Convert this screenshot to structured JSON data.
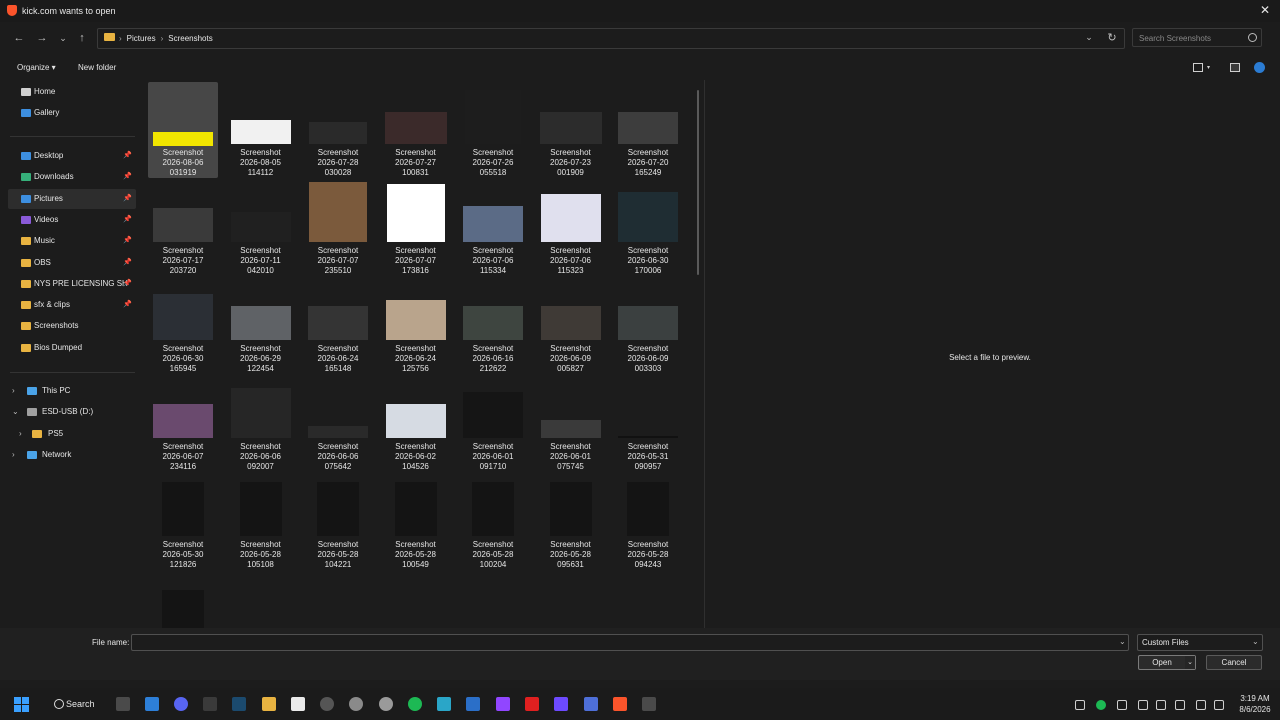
{
  "window": {
    "title": "kick.com wants to open",
    "close_glyph": "✕"
  },
  "nav": {
    "back": "←",
    "forward": "→",
    "recent": "⌄",
    "up": "↑",
    "breadcrumb": [
      "Pictures",
      "Screenshots"
    ],
    "breadcrumb_sep": "›",
    "address_dropdown": "⌄",
    "refresh": "↻",
    "search_placeholder": "Search Screenshots"
  },
  "commands": {
    "organize": "Organize ▾",
    "new_folder": "New folder"
  },
  "sidebar": {
    "quick": [
      {
        "label": "Home",
        "icon": "home-icon"
      },
      {
        "label": "Gallery",
        "icon": "gallery-icon"
      }
    ],
    "pinned": [
      {
        "label": "Desktop",
        "icon": "desktop-icon",
        "pinned": true
      },
      {
        "label": "Downloads",
        "icon": "downloads-icon",
        "pinned": true
      },
      {
        "label": "Pictures",
        "icon": "pictures-icon",
        "pinned": true,
        "selected": true
      },
      {
        "label": "Videos",
        "icon": "videos-icon",
        "pinned": true
      },
      {
        "label": "Music",
        "icon": "folder-icon",
        "pinned": true
      },
      {
        "label": "OBS",
        "icon": "folder-icon",
        "pinned": true
      },
      {
        "label": "NYS PRE LICENSING SH",
        "icon": "folder-icon",
        "pinned": true
      },
      {
        "label": "sfx & clips",
        "icon": "folder-icon",
        "pinned": true
      },
      {
        "label": "Screenshots",
        "icon": "folder-icon"
      },
      {
        "label": "Bios Dumped",
        "icon": "folder-icon"
      }
    ],
    "tree": [
      {
        "label": "This PC",
        "icon": "pc-icon",
        "chevron": "›"
      },
      {
        "label": "ESD-USB (D:)",
        "icon": "usb-drive-icon",
        "chevron": "⌄"
      },
      {
        "label": "PS5",
        "icon": "folder-icon",
        "chevron": "›"
      },
      {
        "label": "Network",
        "icon": "network-icon",
        "chevron": "›"
      }
    ],
    "pin_glyph": "📌"
  },
  "files": [
    {
      "name": "Screenshot\n2026-08-06\n031919",
      "thumb": "#5a5a5a",
      "accent": "#f2e600"
    },
    {
      "name": "Screenshot\n2026-08-05\n114112",
      "thumb": "#f1f1f1"
    },
    {
      "name": "Screenshot\n2026-07-28\n030028",
      "thumb": "#2a2a2a"
    },
    {
      "name": "Screenshot\n2026-07-27\n100831",
      "thumb": "#3b2a2a"
    },
    {
      "name": "Screenshot\n2026-07-26\n055518",
      "thumb": "#1d1d1d"
    },
    {
      "name": "Screenshot\n2026-07-23\n001909",
      "thumb": "#2c2c2c"
    },
    {
      "name": "Screenshot\n2026-07-20\n165249",
      "thumb": "#3d3d3d"
    },
    {
      "name": "Screenshot\n2026-07-17\n203720",
      "thumb": "#3a3a3a"
    },
    {
      "name": "Screenshot\n2026-07-11\n042010",
      "thumb": "#202020"
    },
    {
      "name": "Screenshot\n2026-07-07\n235510",
      "thumb": "#7b5a3c"
    },
    {
      "name": "Screenshot\n2026-07-07\n173816",
      "thumb": "#ffffff"
    },
    {
      "name": "Screenshot\n2026-07-06\n115334",
      "thumb": "#5b6b86"
    },
    {
      "name": "Screenshot\n2026-07-06\n115323",
      "thumb": "#e0e0ee"
    },
    {
      "name": "Screenshot\n2026-06-30\n170006",
      "thumb": "#1f2d33"
    },
    {
      "name": "Screenshot\n2026-06-30\n165945",
      "thumb": "#2b2f35"
    },
    {
      "name": "Screenshot\n2026-06-29\n122454",
      "thumb": "#5f6266"
    },
    {
      "name": "Screenshot\n2026-06-24\n165148",
      "thumb": "#343434"
    },
    {
      "name": "Screenshot\n2026-06-24\n125756",
      "thumb": "#b9a48c"
    },
    {
      "name": "Screenshot\n2026-06-16\n212622",
      "thumb": "#3e4540"
    },
    {
      "name": "Screenshot\n2026-06-09\n005827",
      "thumb": "#3f3a36"
    },
    {
      "name": "Screenshot\n2026-06-09\n003303",
      "thumb": "#3b4040"
    },
    {
      "name": "Screenshot\n2026-06-07\n234116",
      "thumb": "#6a4a6e"
    },
    {
      "name": "Screenshot\n2026-06-06\n092007",
      "thumb": "#262626"
    },
    {
      "name": "Screenshot\n2026-06-06\n075642",
      "thumb": "#2a2a2a"
    },
    {
      "name": "Screenshot\n2026-06-02\n104526",
      "thumb": "#d6dbe3"
    },
    {
      "name": "Screenshot\n2026-06-01\n091710",
      "thumb": "#151515"
    },
    {
      "name": "Screenshot\n2026-06-01\n075745",
      "thumb": "#3a3a3a"
    },
    {
      "name": "Screenshot\n2026-05-31\n090957",
      "thumb": "#111111"
    },
    {
      "name": "Screenshot\n2026-05-30\n121826",
      "thumb": "#141414"
    },
    {
      "name": "Screenshot\n2026-05-28\n105108",
      "thumb": "#141414"
    },
    {
      "name": "Screenshot\n2026-05-28\n104221",
      "thumb": "#141414"
    },
    {
      "name": "Screenshot\n2026-05-28\n100549",
      "thumb": "#141414"
    },
    {
      "name": "Screenshot\n2026-05-28\n100204",
      "thumb": "#141414"
    },
    {
      "name": "Screenshot\n2026-05-28\n095631",
      "thumb": "#141414"
    },
    {
      "name": "Screenshot\n2026-05-28\n094243",
      "thumb": "#141414"
    },
    {
      "name": "",
      "thumb": "#141414"
    }
  ],
  "preview": {
    "text": "Select a file to preview."
  },
  "bottom": {
    "file_name_label": "File name:",
    "file_name_value": "",
    "file_type": "Custom Files",
    "open": "Open",
    "cancel": "Cancel",
    "dropdown_glyph": "⌄"
  },
  "taskbar": {
    "search_label": "Search",
    "clock_time": "3:19 AM",
    "clock_date": "8/6/2026",
    "apps": [
      {
        "icon": "task-view-icon",
        "color": "#4a4a4a"
      },
      {
        "icon": "widgets-icon",
        "color": "#2d7fd8"
      },
      {
        "icon": "discord-icon",
        "color": "#5865f2"
      },
      {
        "icon": "epic-games-icon",
        "color": "#3a3a3a"
      },
      {
        "icon": "steam-icon",
        "color": "#1b4a6e"
      },
      {
        "icon": "file-explorer-icon",
        "color": "#e8b341"
      },
      {
        "icon": "notepad-icon",
        "color": "#eaeaea"
      },
      {
        "icon": "media-player-icon",
        "color": "#555555"
      },
      {
        "icon": "settings-icon",
        "color": "#8a8a8a"
      },
      {
        "icon": "chatgpt-icon",
        "color": "#9a9a9a"
      },
      {
        "icon": "spotify-icon",
        "color": "#1db954"
      },
      {
        "icon": "edge-icon",
        "color": "#2aa6c8"
      },
      {
        "icon": "store-icon",
        "color": "#2b6fc8"
      },
      {
        "icon": "twitch-icon",
        "color": "#9146ff"
      },
      {
        "icon": "youtube-icon",
        "color": "#e02020"
      },
      {
        "icon": "proton-vpn-icon",
        "color": "#6d4aff"
      },
      {
        "icon": "launcher-icon",
        "color": "#4e6fd8"
      },
      {
        "icon": "brave-icon",
        "color": "#fb542b"
      },
      {
        "icon": "capture-icon",
        "color": "#4a4a4a"
      }
    ],
    "tray": [
      {
        "icon": "chevron-up-icon",
        "color": "#cfcfcf"
      },
      {
        "icon": "spotify-tray-icon",
        "color": "#1db954"
      },
      {
        "icon": "microphone-icon",
        "color": "#cfcfcf"
      },
      {
        "icon": "keyboard-icon",
        "color": "#cfcfcf"
      },
      {
        "icon": "network-tray-icon",
        "color": "#cfcfcf"
      },
      {
        "icon": "cast-icon",
        "color": "#cfcfcf"
      },
      {
        "icon": "volume-icon",
        "color": "#cfcfcf"
      },
      {
        "icon": "battery-icon",
        "color": "#cfcfcf"
      }
    ]
  }
}
